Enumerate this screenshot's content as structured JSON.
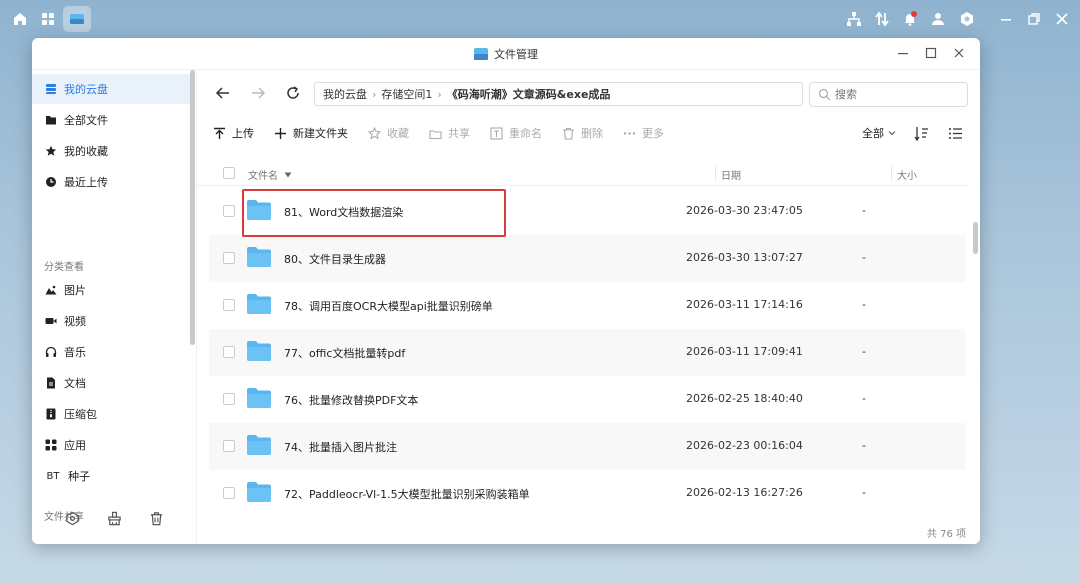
{
  "window": {
    "title": "文件管理"
  },
  "sidebar": {
    "items": [
      {
        "label": "我的云盘",
        "icon": "cloud-drive-icon"
      },
      {
        "label": "全部文件",
        "icon": "folder-icon"
      },
      {
        "label": "我的收藏",
        "icon": "star-icon"
      },
      {
        "label": "最近上传",
        "icon": "clock-icon"
      }
    ],
    "section_category": "分类查看",
    "categories": [
      {
        "label": "图片",
        "icon": "image-icon"
      },
      {
        "label": "视频",
        "icon": "video-icon"
      },
      {
        "label": "音乐",
        "icon": "headphones-icon"
      },
      {
        "label": "文档",
        "icon": "document-icon"
      },
      {
        "label": "压缩包",
        "icon": "archive-icon"
      },
      {
        "label": "应用",
        "icon": "apps-icon"
      },
      {
        "label": "种子",
        "icon": "bt-icon",
        "prefix": "BT"
      }
    ],
    "section_share": "文件共享"
  },
  "breadcrumb": [
    "我的云盘",
    "存储空间1",
    "《码海听潮》文章源码&exe成品"
  ],
  "search": {
    "placeholder": "搜索"
  },
  "toolbar": {
    "upload": "上传",
    "new_folder": "新建文件夹",
    "favorite": "收藏",
    "share": "共享",
    "rename": "重命名",
    "delete": "删除",
    "more": "更多",
    "filter": "全部"
  },
  "table": {
    "headers": {
      "name": "文件名",
      "date": "日期",
      "size": "大小"
    },
    "rows": [
      {
        "name": "81、Word文档数据渲染",
        "date": "2026-03-30 23:47:05",
        "size": "-"
      },
      {
        "name": "80、文件目录生成器",
        "date": "2026-03-30 13:07:27",
        "size": "-"
      },
      {
        "name": "78、调用百度OCR大模型api批量识别磅单",
        "date": "2026-03-11 17:14:16",
        "size": "-"
      },
      {
        "name": "77、offic文档批量转pdf",
        "date": "2026-03-11 17:09:41",
        "size": "-"
      },
      {
        "name": "76、批量修改替换PDF文本",
        "date": "2026-02-25 18:40:40",
        "size": "-"
      },
      {
        "name": "74、批量插入图片批注",
        "date": "2026-02-23 00:16:04",
        "size": "-"
      },
      {
        "name": "72、Paddleocr-Vl-1.5大模型批量识别采购装箱单",
        "date": "2026-02-13 16:27:26",
        "size": "-"
      }
    ]
  },
  "footer": {
    "count": "共 76 项"
  },
  "colors": {
    "accent": "#2f7de1",
    "folder": "#5bb6f0",
    "highlight": "#d93a3a"
  }
}
